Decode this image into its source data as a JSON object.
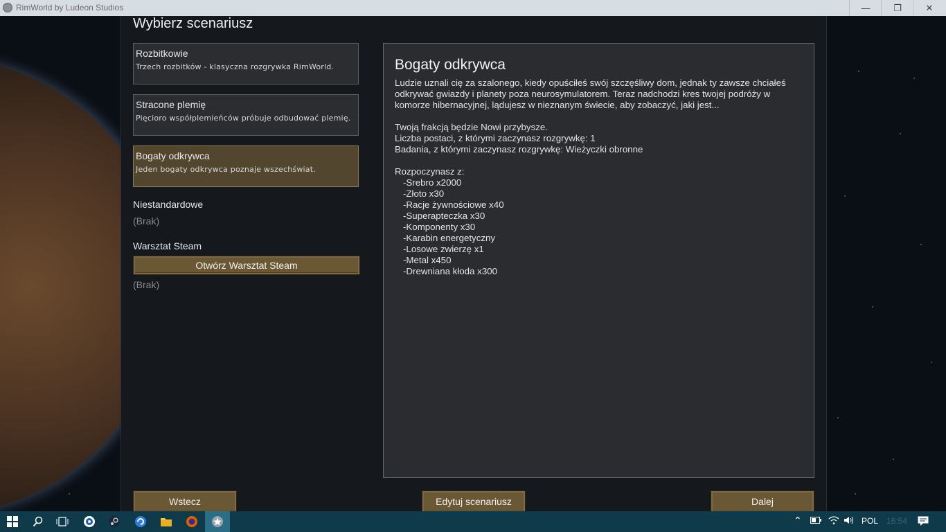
{
  "window": {
    "title": "RimWorld by Ludeon Studios",
    "minimize": "—",
    "maximize": "❐",
    "close": "✕"
  },
  "page": {
    "title": "Wybierz scenariusz"
  },
  "scenarios": [
    {
      "name": "Rozbitkowie",
      "desc": "Trzech rozbitków - klasyczna rozgrywka RimWorld."
    },
    {
      "name": "Stracone plemię",
      "desc": "Pięcioro współplemieńców próbuje odbudować plemię."
    },
    {
      "name": "Bogaty odkrywca",
      "desc": "Jeden bogaty odkrywca poznaje wszechświat."
    }
  ],
  "custom": {
    "label": "Niestandardowe",
    "empty": "(Brak)"
  },
  "workshop": {
    "label": "Warsztat Steam",
    "button": "Otwórz Warsztat Steam",
    "empty": "(Brak)"
  },
  "detail": {
    "title": "Bogaty odkrywca",
    "intro": "Ludzie uznali cię za szalonego, kiedy opuściłeś swój szczęśliwy dom, jednak ty zawsze chciałeś odkrywać gwiazdy i planety poza neurosymulatorem. Teraz nadchodzi kres twojej podróży w komorze hibernacyjnej, lądujesz w nieznanym świecie, aby zobaczyć, jaki jest...",
    "faction": "Twoją frakcją będzie Nowi przybysze.",
    "colonists": "Liczba postaci, z którymi zaczynasz rozgrywkę: 1",
    "research": "Badania, z którymi zaczynasz rozgrywkę: Wieżyczki obronne",
    "start_header": "Rozpoczynasz z:",
    "items": [
      "-Srebro x2000",
      "-Złoto x30",
      "-Racje żywnościowe x40",
      "-Superapteczka x30",
      "-Komponenty x30",
      "-Karabin energetyczny",
      "-Losowe zwierzę x1",
      "-Metal x450",
      "-Drewniana kłoda x300"
    ]
  },
  "buttons": {
    "back": "Wstecz",
    "edit": "Edytuj scenariusz",
    "next": "Dalej"
  },
  "taskbar": {
    "lang": "POL",
    "time": "16:54"
  },
  "colors": {
    "accent": "#6a5834",
    "selected": "#53462f",
    "taskbar": "#0f3a4a"
  }
}
